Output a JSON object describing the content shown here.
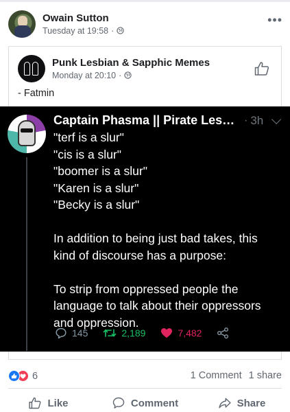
{
  "post": {
    "author": "Owain Sutton",
    "timestamp": "Tuesday at 19:58",
    "privacy_icon": "globe-icon",
    "more_icon": "more-options-icon",
    "more_label": "•••"
  },
  "shared": {
    "page_name": "Punk Lesbian & Sapphic Memes",
    "timestamp": "Monday at 20:10",
    "privacy_icon": "globe-icon",
    "like_page_icon": "thumbs-up-outline-icon",
    "caption": "- Fatmin"
  },
  "tweet": {
    "display_name": "Captain Phasma || Pirate Lesbia...",
    "separator": "·",
    "time": "3h",
    "lines": [
      "\"terf is a slur\"",
      "\"cis is a slur\"",
      "\"boomer is a slur\"",
      "\"Karen is a slur\"",
      "\"Becky is a slur\"",
      "",
      "In addition to being just bad takes, this kind of discourse has a purpose:",
      "",
      "To strip from oppressed people the language to talk about their oppressors and oppression."
    ],
    "replies": "145",
    "retweets": "2,189",
    "likes": "7,482",
    "colors": {
      "background": "#000000",
      "retweet": "#17bf63",
      "like": "#e0245e",
      "muted": "#6e767d"
    }
  },
  "engagement": {
    "reaction_icons": [
      "like-reaction-icon",
      "love-reaction-icon"
    ],
    "reaction_count": "6",
    "comments": "1 Comment",
    "shares": "1 share"
  },
  "actions": {
    "like_label": "Like",
    "comment_label": "Comment",
    "share_label": "Share"
  },
  "colors": {
    "facebook_blue": "#1877f2",
    "love_red": "#f33e58",
    "text_muted": "#606770"
  }
}
